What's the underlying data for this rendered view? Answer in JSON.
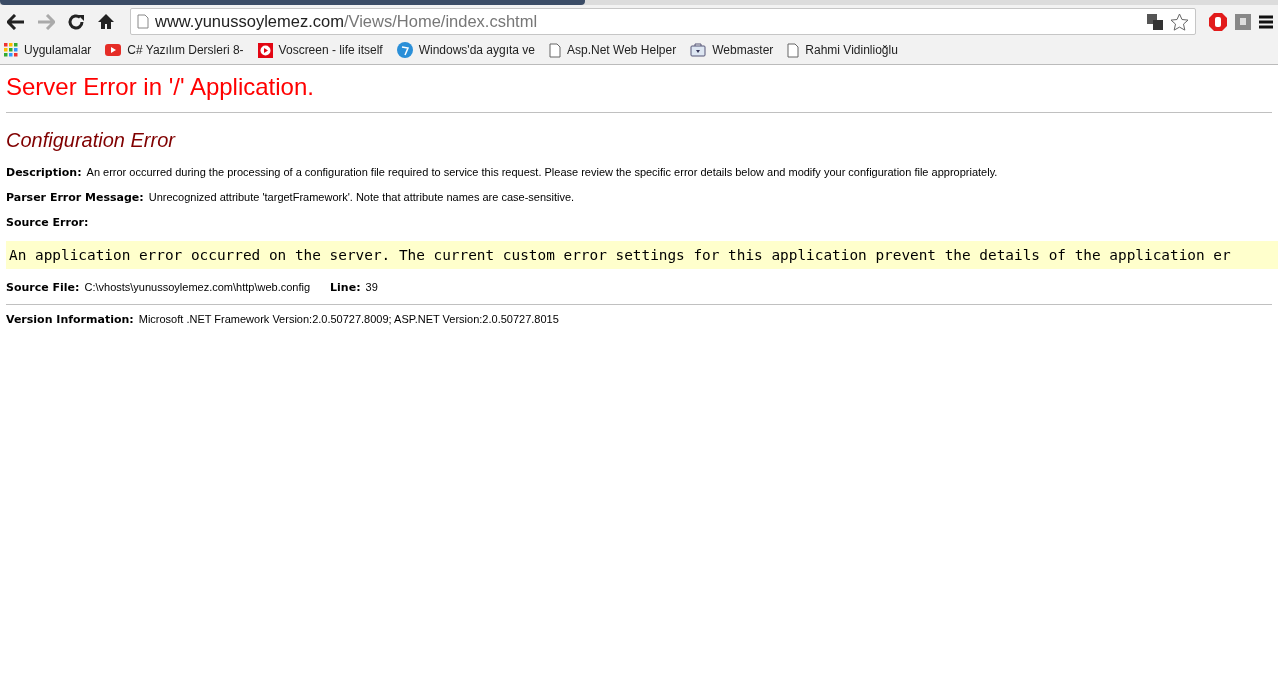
{
  "browser": {
    "url_domain": "www.yunussoylemez.com",
    "url_path": "/Views/Home/index.cshtml",
    "forward_disabled": true,
    "bookmarks": [
      {
        "kind": "apps",
        "label": "Uygulamalar"
      },
      {
        "kind": "youtube",
        "label": "C# Yazılım Dersleri 8-"
      },
      {
        "kind": "voscreen",
        "label": "Voscreen - life itself"
      },
      {
        "kind": "globe",
        "label": "Windows'da aygıta ve"
      },
      {
        "kind": "page",
        "label": "Asp.Net Web Helper"
      },
      {
        "kind": "webmaster",
        "label": "Webmaster"
      },
      {
        "kind": "page",
        "label": "Rahmi Vidinlioğlu"
      }
    ]
  },
  "page": {
    "title": "Server Error in '/' Application.",
    "subtitle": "Configuration Error",
    "description_label": "Description:",
    "description": "An error occurred during the processing of a configuration file required to service this request. Please review the specific error details below and modify your configuration file appropriately.",
    "parser_label": "Parser Error Message:",
    "parser_message": "Unrecognized attribute 'targetFramework'. Note that attribute names are case-sensitive.",
    "source_error_label": "Source Error:",
    "source_error": "An application error occurred on the server. The current custom error settings for this application prevent the details of the application er",
    "source_file_label": "Source File:",
    "source_file": "C:\\vhosts\\yunussoylemez.com\\http\\web.config",
    "line_label": "Line:",
    "line": "39",
    "version_label": "Version Information:",
    "version": "Microsoft .NET Framework Version:2.0.50727.8009; ASP.NET Version:2.0.50727.8015"
  }
}
